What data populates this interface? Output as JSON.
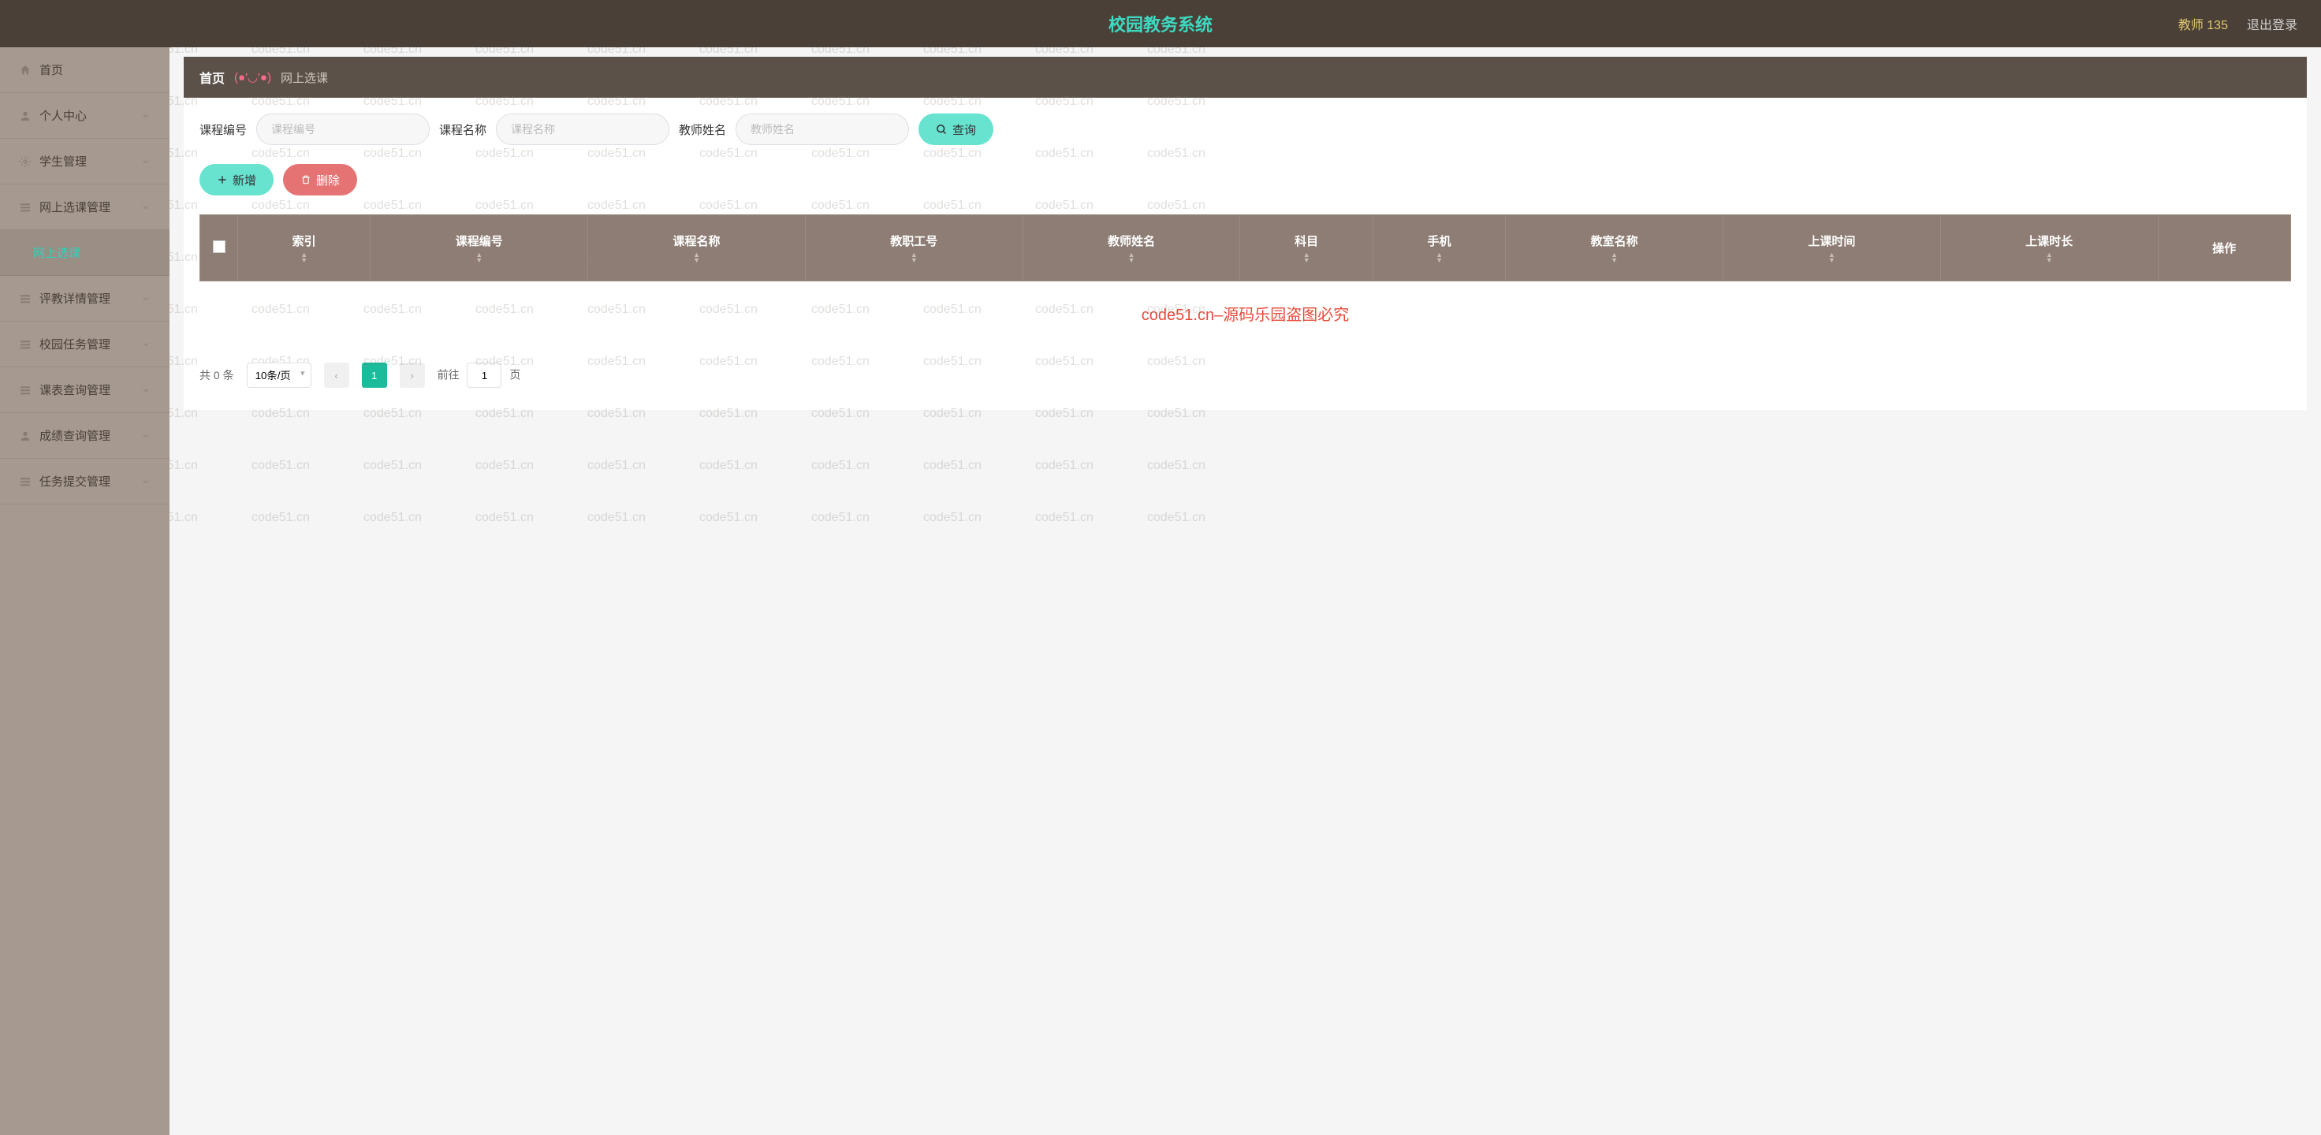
{
  "header": {
    "title": "校园教务系统",
    "user_label": "教师 135",
    "logout_label": "退出登录"
  },
  "sidebar": {
    "items": [
      {
        "label": "首页",
        "icon": "home",
        "expandable": false,
        "active": false
      },
      {
        "label": "个人中心",
        "icon": "user",
        "expandable": true,
        "active": false
      },
      {
        "label": "学生管理",
        "icon": "gear",
        "expandable": true,
        "active": false
      },
      {
        "label": "网上选课管理",
        "icon": "list",
        "expandable": true,
        "active": false
      },
      {
        "label": "网上选课",
        "icon": "",
        "expandable": false,
        "active": true,
        "sub": true
      },
      {
        "label": "评教详情管理",
        "icon": "list",
        "expandable": true,
        "active": false
      },
      {
        "label": "校园任务管理",
        "icon": "list",
        "expandable": true,
        "active": false
      },
      {
        "label": "课表查询管理",
        "icon": "list",
        "expandable": true,
        "active": false
      },
      {
        "label": "成绩查询管理",
        "icon": "user",
        "expandable": true,
        "active": false
      },
      {
        "label": "任务提交管理",
        "icon": "list",
        "expandable": true,
        "active": false
      }
    ]
  },
  "breadcrumb": {
    "home": "首页",
    "emoji": "(●'◡'●)",
    "current": "网上选课"
  },
  "search": {
    "fields": [
      {
        "label": "课程编号",
        "placeholder": "课程编号"
      },
      {
        "label": "课程名称",
        "placeholder": "课程名称"
      },
      {
        "label": "教师姓名",
        "placeholder": "教师姓名"
      }
    ],
    "query_btn": "查询"
  },
  "actions": {
    "add": "新增",
    "delete": "删除"
  },
  "table": {
    "columns": [
      "索引",
      "课程编号",
      "课程名称",
      "教职工号",
      "教师姓名",
      "科目",
      "手机",
      "教室名称",
      "上课时间",
      "上课时长",
      "操作"
    ],
    "empty_text": "code51.cn–源码乐园盗图必究"
  },
  "pagination": {
    "total_prefix": "共",
    "total_count": "0",
    "total_suffix": "条",
    "page_size": "10条/页",
    "current_page": "1",
    "jump_prefix": "前往",
    "jump_value": "1",
    "jump_suffix": "页"
  },
  "watermark_text": "code51.cn"
}
